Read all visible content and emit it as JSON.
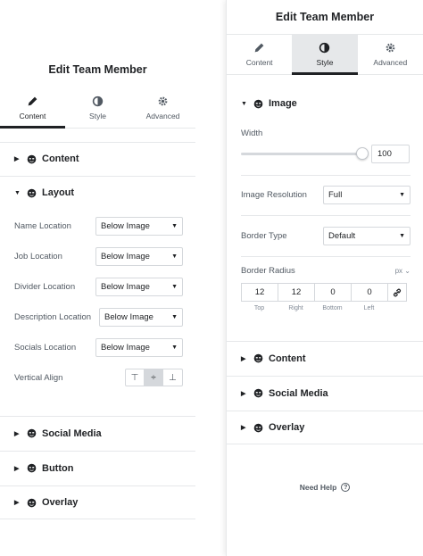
{
  "left": {
    "title": "Edit Team Member",
    "tabs": [
      {
        "label": "Content",
        "icon": "pencil-icon",
        "active": true
      },
      {
        "label": "Style",
        "icon": "half-circle-icon",
        "active": false
      },
      {
        "label": "Advanced",
        "icon": "gear-icon",
        "active": false
      }
    ],
    "sections": {
      "content": "Content",
      "layout": "Layout",
      "social_media": "Social Media",
      "button": "Button",
      "overlay": "Overlay"
    },
    "controls": [
      {
        "label": "Name Location",
        "value": "Below Image"
      },
      {
        "label": "Job Location",
        "value": "Below Image"
      },
      {
        "label": "Divider Location",
        "value": "Below Image"
      },
      {
        "label": "Description Location",
        "value": "Below Image"
      },
      {
        "label": "Socials Location",
        "value": "Below Image"
      }
    ],
    "vertical_align": {
      "label": "Vertical Align",
      "options": [
        "⊤",
        "÷",
        "⊥"
      ],
      "selected": "middle"
    }
  },
  "right": {
    "title": "Edit Team Member",
    "tabs": [
      {
        "label": "Content",
        "icon": "pencil-icon",
        "active": false
      },
      {
        "label": "Style",
        "icon": "half-circle-icon",
        "active": true
      },
      {
        "label": "Advanced",
        "icon": "gear-icon",
        "active": false
      }
    ],
    "image_section": "Image",
    "width": {
      "label": "Width",
      "value": "100",
      "slider_fraction": 1.0
    },
    "image_resolution": {
      "label": "Image Resolution",
      "value": "Full"
    },
    "border_type": {
      "label": "Border Type",
      "value": "Default"
    },
    "border_radius": {
      "label": "Border Radius",
      "unit": "px",
      "values": [
        "12",
        "12",
        "0",
        "0"
      ],
      "labels": [
        "Top",
        "Right",
        "Bottom",
        "Left"
      ]
    },
    "sections": {
      "content": "Content",
      "social_media": "Social Media",
      "overlay": "Overlay"
    },
    "need_help": "Need Help",
    "colors": {
      "text": "#1f2124",
      "muted": "#515962",
      "border": "#d5d8dc",
      "active_tab_bg": "#e6e8ea"
    }
  }
}
